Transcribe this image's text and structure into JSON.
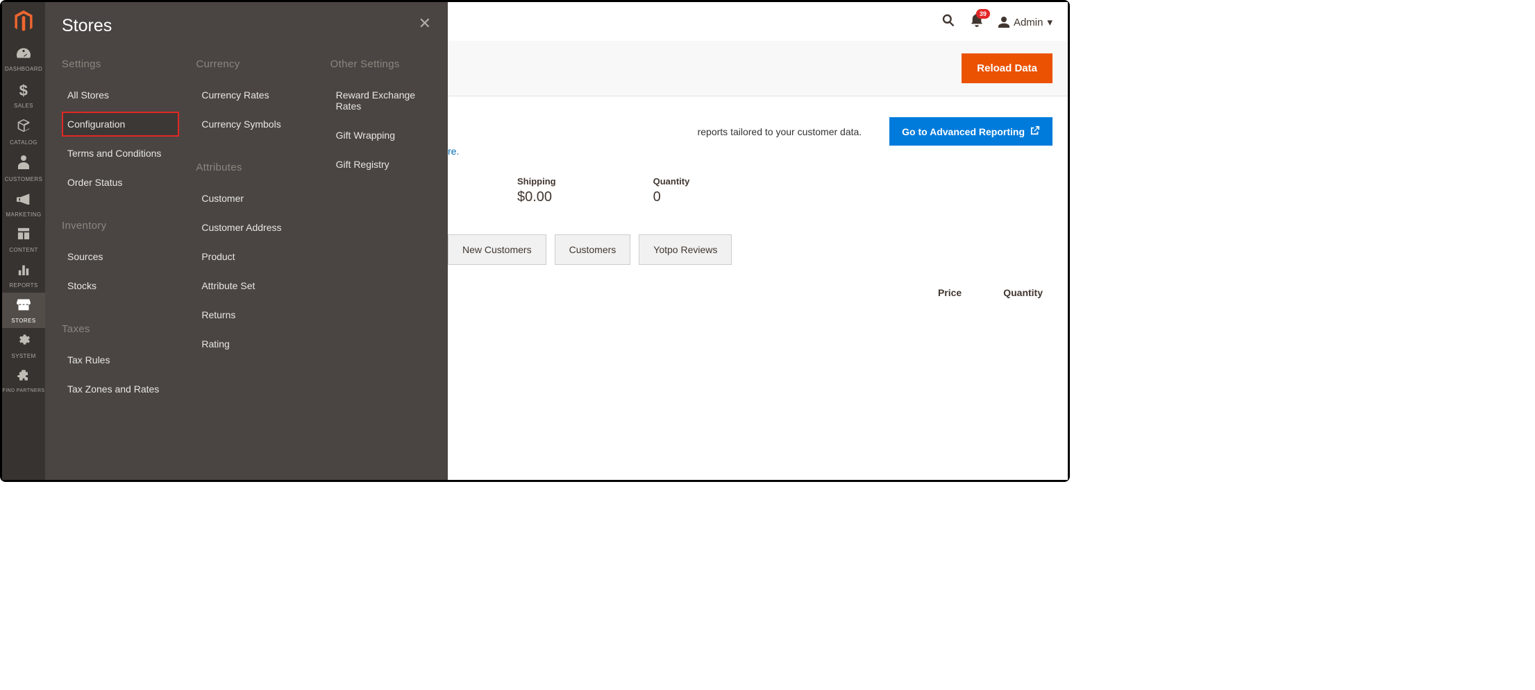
{
  "sidebar": {
    "items": [
      {
        "label": "DASHBOARD",
        "icon": "📊"
      },
      {
        "label": "SALES",
        "icon": "$"
      },
      {
        "label": "CATALOG",
        "icon": "📦"
      },
      {
        "label": "CUSTOMERS",
        "icon": "👤"
      },
      {
        "label": "MARKETING",
        "icon": "📢"
      },
      {
        "label": "CONTENT",
        "icon": "▦"
      },
      {
        "label": "REPORTS",
        "icon": "📈"
      },
      {
        "label": "STORES",
        "icon": "🏬",
        "active": true
      },
      {
        "label": "SYSTEM",
        "icon": "⚙"
      },
      {
        "label": "FIND PARTNERS",
        "icon": "◆"
      }
    ]
  },
  "flyout": {
    "title": "Stores",
    "columns": [
      {
        "sections": [
          {
            "heading": "Settings",
            "links": [
              "All Stores",
              "Configuration",
              "Terms and Conditions",
              "Order Status"
            ],
            "highlight_index": 1
          },
          {
            "heading": "Inventory",
            "links": [
              "Sources",
              "Stocks"
            ]
          },
          {
            "heading": "Taxes",
            "links": [
              "Tax Rules",
              "Tax Zones and Rates"
            ]
          }
        ]
      },
      {
        "sections": [
          {
            "heading": "Currency",
            "links": [
              "Currency Rates",
              "Currency Symbols"
            ]
          },
          {
            "heading": "Attributes",
            "links": [
              "Customer",
              "Customer Address",
              "Product",
              "Attribute Set",
              "Returns",
              "Rating"
            ]
          }
        ]
      },
      {
        "sections": [
          {
            "heading": "Other Settings",
            "links": [
              "Reward Exchange Rates",
              "Gift Wrapping",
              "Gift Registry"
            ]
          }
        ]
      }
    ]
  },
  "header": {
    "notifications_count": "39",
    "admin_label": "Admin"
  },
  "reload": {
    "label": "Reload Data"
  },
  "advanced": {
    "tail_text": "reports tailored to your customer data.",
    "button_label": "Go to Advanced Reporting",
    "link_tail": "re."
  },
  "stats": [
    {
      "label": "Shipping",
      "value": "$0.00"
    },
    {
      "label": "Quantity",
      "value": "0"
    }
  ],
  "tabs": [
    "New Customers",
    "Customers",
    "Yotpo Reviews"
  ],
  "table": {
    "price_header": "Price",
    "qty_header": "Quantity"
  }
}
